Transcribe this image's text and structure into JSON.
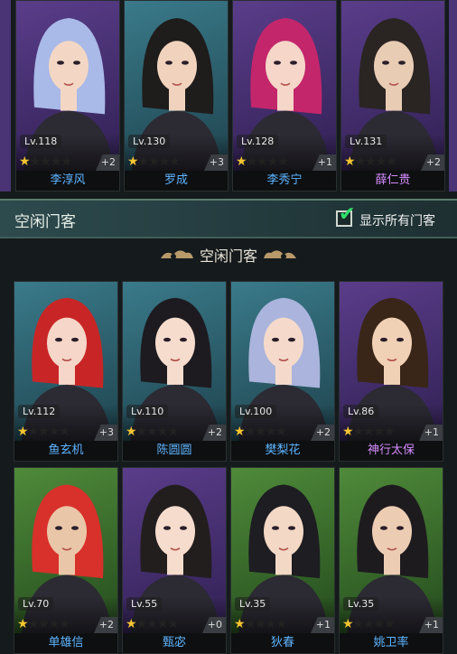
{
  "top_row": [
    {
      "level": "Lv.118",
      "stars": 1,
      "bonus": "+2",
      "name": "李淳风",
      "name_color": "blue",
      "bg": "purple",
      "hair": "#a9b9e8",
      "skin": "#f3d7c4"
    },
    {
      "level": "Lv.130",
      "stars": 1,
      "bonus": "+3",
      "name": "罗成",
      "name_color": "blue",
      "bg": "teal",
      "hair": "#1f1c1c",
      "skin": "#f1d3bd"
    },
    {
      "level": "Lv.128",
      "stars": 1,
      "bonus": "+1",
      "name": "李秀宁",
      "name_color": "blue",
      "bg": "purple",
      "hair": "#c3266b",
      "skin": "#f5d6c8"
    },
    {
      "level": "Lv.131",
      "stars": 1,
      "bonus": "+2",
      "name": "薛仁贵",
      "name_color": "purple",
      "bg": "purple",
      "hair": "#2a2422",
      "skin": "#e9ccb4"
    }
  ],
  "section": {
    "title": "空闲门客",
    "checkbox_label": "显示所有门客",
    "checkbox_checked": true,
    "subtitle": "空闲门客"
  },
  "idle_rows": [
    [
      {
        "level": "Lv.112",
        "stars": 1,
        "bonus": "+3",
        "name": "鱼玄机",
        "name_color": "blue",
        "bg": "teal",
        "hair": "#c82626",
        "skin": "#f5d6c8"
      },
      {
        "level": "Lv.110",
        "stars": 1,
        "bonus": "+2",
        "name": "陈圆圆",
        "name_color": "blue",
        "bg": "teal",
        "hair": "#1d1b20",
        "skin": "#f6dccd"
      },
      {
        "level": "Lv.100",
        "stars": 1,
        "bonus": "+2",
        "name": "樊梨花",
        "name_color": "blue",
        "bg": "teal",
        "hair": "#aab4dc",
        "skin": "#f5dacb"
      },
      {
        "level": "Lv.86",
        "stars": 1,
        "bonus": "+1",
        "name": "神行太保",
        "name_color": "purple",
        "bg": "purple",
        "hair": "#3a2618",
        "skin": "#f1d1b5"
      }
    ],
    [
      {
        "level": "Lv.70",
        "stars": 1,
        "bonus": "+2",
        "name": "单雄信",
        "name_color": "blue",
        "bg": "green",
        "hair": "#d8302a",
        "skin": "#eac6a8"
      },
      {
        "level": "Lv.55",
        "stars": 1,
        "bonus": "+0",
        "name": "甄宓",
        "name_color": "blue",
        "bg": "purple",
        "hair": "#231e1e",
        "skin": "#f6dccd"
      },
      {
        "level": "Lv.35",
        "stars": 1,
        "bonus": "+1",
        "name": "狄春",
        "name_color": "blue",
        "bg": "green",
        "hair": "#1d1d22",
        "skin": "#f3d8c5"
      },
      {
        "level": "Lv.35",
        "stars": 1,
        "bonus": "+1",
        "name": "姚卫率",
        "name_color": "blue",
        "bg": "green",
        "hair": "#1e1b1f",
        "skin": "#eccdb4"
      }
    ]
  ],
  "star_max": 5
}
